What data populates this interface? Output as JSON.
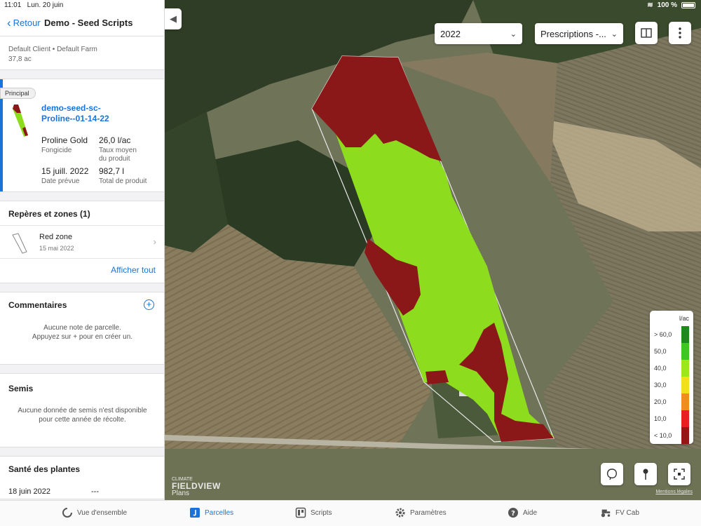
{
  "status": {
    "time": "11:01",
    "date": "Lun. 20 juin",
    "battery": "100 %"
  },
  "header": {
    "back_label": "Retour",
    "title": "Demo - Seed Scripts"
  },
  "farm": {
    "client_farm": "Default Client • Default Farm",
    "area": "37,8 ac"
  },
  "prescription": {
    "tag": "Principal",
    "name_line1": "demo-seed-sc-",
    "name_line2": "Proline--01-14-22",
    "product": "Proline Gold",
    "product_type": "Fongicide",
    "rate": "26,0 l/ac",
    "rate_label_1": "Taux moyen",
    "rate_label_2": "du produit",
    "date": "15 juill. 2022",
    "date_label": "Date prévue",
    "total": "982,7 l",
    "total_label": "Total de produit"
  },
  "zones": {
    "title": "Repères et zones (1)",
    "items": [
      {
        "name": "Red zone",
        "date": "15 mai 2022"
      }
    ],
    "show_all": "Afficher tout"
  },
  "comments": {
    "title": "Commentaires",
    "empty_line1": "Aucune note de parcelle.",
    "empty_line2": "Appuyez sur + pour en créer un."
  },
  "semis": {
    "title": "Semis",
    "empty_line1": "Aucune donnée de semis n'est disponible",
    "empty_line2": "pour cette année de récolte."
  },
  "sante": {
    "title": "Santé des plantes",
    "date": "18 juin 2022",
    "value": "---"
  },
  "map": {
    "year": "2022",
    "layer": "Prescriptions -...",
    "legend": {
      "unit": "l/ac",
      "items": [
        {
          "label": "> 60,0",
          "color": "#1e8a1e"
        },
        {
          "label": "50,0",
          "color": "#3cc81e"
        },
        {
          "label": "40,0",
          "color": "#9be61e"
        },
        {
          "label": "30,0",
          "color": "#f2e01e"
        },
        {
          "label": "20,0",
          "color": "#f28c1e"
        },
        {
          "label": "10,0",
          "color": "#e62020"
        },
        {
          "label": "< 10,0",
          "color": "#9b1414"
        }
      ]
    },
    "brand_small": "CLIMATE",
    "brand_big": "FIELDVIEW",
    "plans": "Plans",
    "legal": "Mentions légales"
  },
  "nav": {
    "items": [
      {
        "label": "Vue d'ensemble",
        "icon": "overview-icon"
      },
      {
        "label": "Parcelles",
        "icon": "fields-icon"
      },
      {
        "label": "Scripts",
        "icon": "scripts-icon"
      },
      {
        "label": "Paramètres",
        "icon": "gear-icon"
      },
      {
        "label": "Aide",
        "icon": "help-icon"
      },
      {
        "label": "FV Cab",
        "icon": "tractor-icon"
      }
    ]
  }
}
